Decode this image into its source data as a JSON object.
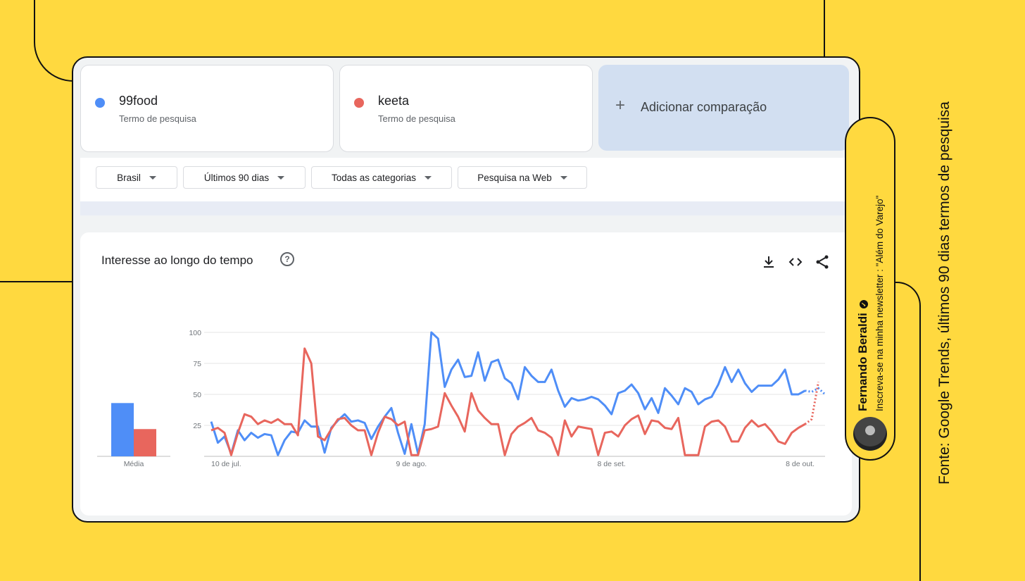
{
  "terms": [
    {
      "name": "99food",
      "subtitle": "Termo de pesquisa",
      "color": "#4F8EF7"
    },
    {
      "name": "keeta",
      "subtitle": "Termo de pesquisa",
      "color": "#E8665D"
    }
  ],
  "add_comparison": {
    "icon": "+",
    "label": "Adicionar comparação"
  },
  "filters": {
    "region": "Brasil",
    "period": "Últimos 90 dias",
    "category": "Todas as categorias",
    "search_type": "Pesquisa na Web"
  },
  "panel": {
    "title": "Interesse ao longo do tempo",
    "help_icon": "?",
    "icons": [
      "download-icon",
      "embed-code-icon",
      "share-icon"
    ]
  },
  "author": {
    "name": "Fernando Beraldi",
    "tagline": "Inscreva-se na minha newsletter : \"Além do Varejo\""
  },
  "source_note": "Fonte: Google Trends, últimos 90 dias termos de pesquisa",
  "chart_data": {
    "type": "line",
    "ylim": [
      0,
      100
    ],
    "yticks": [
      100,
      75,
      50,
      25
    ],
    "xticks": [
      {
        "label": "10 de jul.",
        "index": 0
      },
      {
        "label": "9 de ago.",
        "index": 30
      },
      {
        "label": "8 de set.",
        "index": 60
      },
      {
        "label": "8 de out.",
        "index": 90
      }
    ],
    "average_label": "Média",
    "averages": [
      {
        "term": "99food",
        "value": 43
      },
      {
        "term": "keeta",
        "value": 22
      }
    ],
    "partial_from_index": 89,
    "series": [
      {
        "name": "99food",
        "color": "#4F8EF7",
        "values": [
          28,
          11,
          16,
          2,
          21,
          13,
          19,
          15,
          18,
          17,
          1,
          13,
          20,
          19,
          29,
          24,
          24,
          3,
          23,
          29,
          34,
          28,
          29,
          27,
          14,
          24,
          32,
          39,
          19,
          2,
          26,
          2,
          26,
          100,
          95,
          56,
          70,
          78,
          64,
          65,
          84,
          61,
          76,
          78,
          63,
          59,
          46,
          72,
          65,
          60,
          60,
          70,
          53,
          40,
          47,
          45,
          46,
          48,
          46,
          41,
          34,
          51,
          53,
          58,
          51,
          38,
          47,
          35,
          55,
          49,
          42,
          55,
          52,
          42,
          46,
          48,
          58,
          72,
          60,
          70,
          59,
          52,
          57,
          57,
          57,
          62,
          70,
          50,
          50,
          53,
          52,
          55,
          50
        ]
      },
      {
        "name": "keeta",
        "color": "#E8665D",
        "values": [
          21,
          23,
          19,
          1,
          19,
          34,
          32,
          26,
          29,
          27,
          30,
          26,
          26,
          17,
          87,
          75,
          16,
          13,
          22,
          30,
          31,
          25,
          21,
          21,
          1,
          19,
          32,
          30,
          25,
          28,
          1,
          1,
          21,
          22,
          24,
          51,
          41,
          32,
          20,
          51,
          37,
          31,
          26,
          26,
          1,
          18,
          24,
          27,
          31,
          21,
          19,
          15,
          1,
          29,
          16,
          24,
          23,
          22,
          1,
          19,
          20,
          16,
          25,
          30,
          33,
          18,
          29,
          28,
          23,
          22,
          31,
          1,
          1,
          1,
          24,
          28,
          29,
          24,
          12,
          12,
          23,
          29,
          24,
          26,
          20,
          12,
          10,
          19,
          23,
          26,
          30,
          60
        ]
      }
    ]
  }
}
